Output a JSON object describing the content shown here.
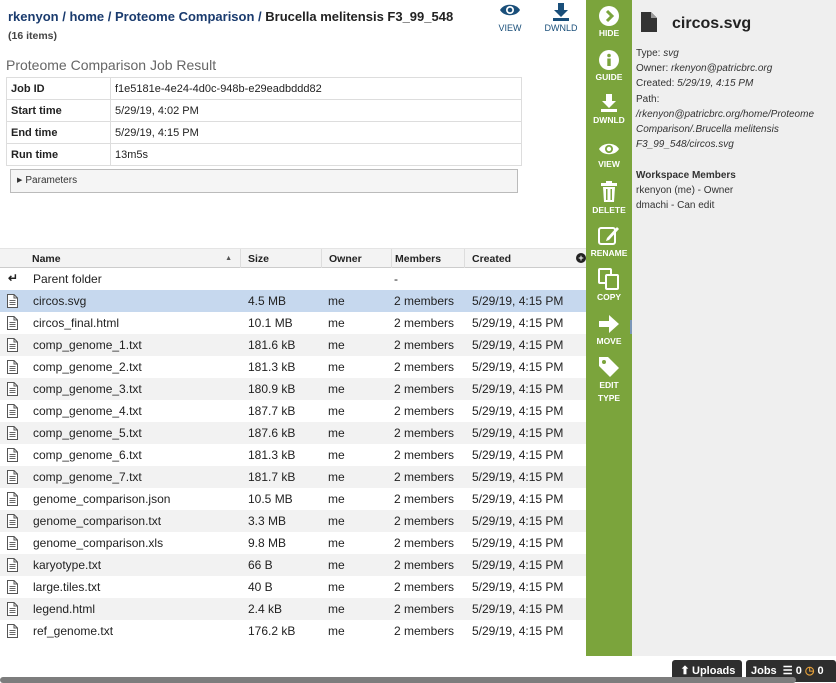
{
  "breadcrumb": {
    "user": "rkenyon",
    "home": "home",
    "folder": "Proteome Comparison",
    "current": "Brucella melitensis F3_99_548",
    "count": "(16 items)"
  },
  "topbar": {
    "view_label": "VIEW",
    "download_label": "DWNLD"
  },
  "job": {
    "title": "Proteome Comparison Job Result",
    "rows": [
      {
        "key": "Job ID",
        "value": "f1e5181e-4e24-4d0c-948b-e29eadbddd82"
      },
      {
        "key": "Start time",
        "value": "5/29/19, 4:02 PM"
      },
      {
        "key": "End time",
        "value": "5/29/19, 4:15 PM"
      },
      {
        "key": "Run time",
        "value": "13m5s"
      }
    ],
    "parameters_label": "Parameters"
  },
  "grid": {
    "columns": {
      "name": "Name",
      "size": "Size",
      "owner": "Owner",
      "members": "Members",
      "created": "Created"
    },
    "parent": {
      "name": "Parent folder",
      "members": "-"
    },
    "files": [
      {
        "name": "circos.svg",
        "size": "4.5 MB",
        "owner": "me",
        "members": "2 members",
        "created": "5/29/19, 4:15 PM"
      },
      {
        "name": "circos_final.html",
        "size": "10.1 MB",
        "owner": "me",
        "members": "2 members",
        "created": "5/29/19, 4:15 PM"
      },
      {
        "name": "comp_genome_1.txt",
        "size": "181.6 kB",
        "owner": "me",
        "members": "2 members",
        "created": "5/29/19, 4:15 PM"
      },
      {
        "name": "comp_genome_2.txt",
        "size": "181.3 kB",
        "owner": "me",
        "members": "2 members",
        "created": "5/29/19, 4:15 PM"
      },
      {
        "name": "comp_genome_3.txt",
        "size": "180.9 kB",
        "owner": "me",
        "members": "2 members",
        "created": "5/29/19, 4:15 PM"
      },
      {
        "name": "comp_genome_4.txt",
        "size": "187.7 kB",
        "owner": "me",
        "members": "2 members",
        "created": "5/29/19, 4:15 PM"
      },
      {
        "name": "comp_genome_5.txt",
        "size": "187.6 kB",
        "owner": "me",
        "members": "2 members",
        "created": "5/29/19, 4:15 PM"
      },
      {
        "name": "comp_genome_6.txt",
        "size": "181.3 kB",
        "owner": "me",
        "members": "2 members",
        "created": "5/29/19, 4:15 PM"
      },
      {
        "name": "comp_genome_7.txt",
        "size": "181.7 kB",
        "owner": "me",
        "members": "2 members",
        "created": "5/29/19, 4:15 PM"
      },
      {
        "name": "genome_comparison.json",
        "size": "10.5 MB",
        "owner": "me",
        "members": "2 members",
        "created": "5/29/19, 4:15 PM"
      },
      {
        "name": "genome_comparison.txt",
        "size": "3.3 MB",
        "owner": "me",
        "members": "2 members",
        "created": "5/29/19, 4:15 PM"
      },
      {
        "name": "genome_comparison.xls",
        "size": "9.8 MB",
        "owner": "me",
        "members": "2 members",
        "created": "5/29/19, 4:15 PM"
      },
      {
        "name": "karyotype.txt",
        "size": "66 B",
        "owner": "me",
        "members": "2 members",
        "created": "5/29/19, 4:15 PM"
      },
      {
        "name": "large.tiles.txt",
        "size": "40 B",
        "owner": "me",
        "members": "2 members",
        "created": "5/29/19, 4:15 PM"
      },
      {
        "name": "legend.html",
        "size": "2.4 kB",
        "owner": "me",
        "members": "2 members",
        "created": "5/29/19, 4:15 PM"
      },
      {
        "name": "ref_genome.txt",
        "size": "176.2 kB",
        "owner": "me",
        "members": "2 members",
        "created": "5/29/19, 4:15 PM"
      }
    ]
  },
  "actions": {
    "hide": "HIDE",
    "guide": "GUIDE",
    "download": "DWNLD",
    "view": "VIEW",
    "delete": "DELETE",
    "rename": "RENAME",
    "copy": "COPY",
    "move": "MOVE",
    "edit_line1": "EDIT",
    "edit_line2": "TYPE"
  },
  "detail": {
    "title": "circos.svg",
    "type_label": "Type:",
    "type_value": "svg",
    "owner_label": "Owner:",
    "owner_value": "rkenyon@patricbrc.org",
    "created_label": "Created:",
    "created_value": "5/29/19, 4:15 PM",
    "path_label": "Path:",
    "path_line1": "/rkenyon@patricbrc.org/home/Proteome",
    "path_line2": "Comparison/.Brucella melitensis",
    "path_line3": "F3_99_548/circos.svg",
    "members_heading": "Workspace Members",
    "member_1": "rkenyon (me) - Owner",
    "member_2": "dmachi - Can edit"
  },
  "footer": {
    "uploads": "Uploads",
    "jobs": "Jobs",
    "jobs_count_a": "0",
    "jobs_count_b": "0"
  },
  "colors": {
    "action_bar": "#7ba43c",
    "selected_row": "#c6d8ee",
    "link": "#1a3b6e"
  }
}
